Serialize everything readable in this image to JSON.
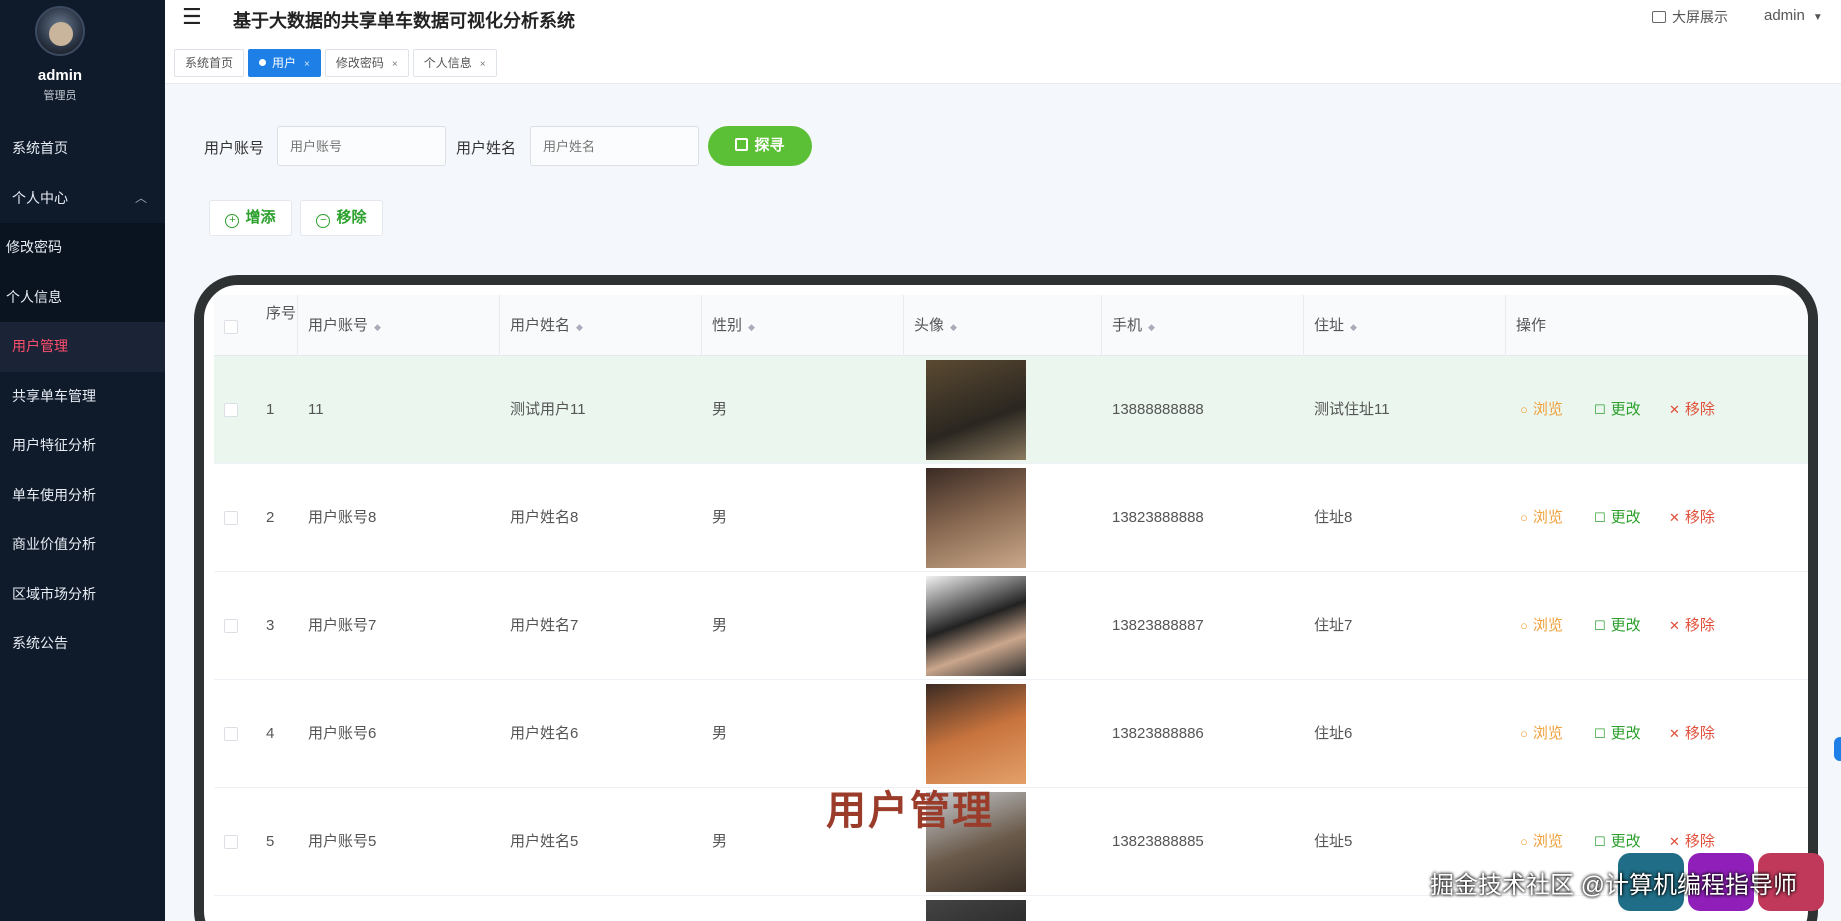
{
  "sidebar": {
    "user_name": "admin",
    "user_role": "管理员",
    "items": [
      {
        "label": "系统首页"
      },
      {
        "label": "个人中心"
      },
      {
        "label": "修改密码"
      },
      {
        "label": "个人信息"
      },
      {
        "label": "用户管理"
      },
      {
        "label": "共享单车管理"
      },
      {
        "label": "用户特征分析"
      },
      {
        "label": "单车使用分析"
      },
      {
        "label": "商业价值分析"
      },
      {
        "label": "区域市场分析"
      },
      {
        "label": "系统公告"
      }
    ]
  },
  "header": {
    "title": "基于大数据的共享单车数据可视化分析系统",
    "big_screen": "大屏展示",
    "admin": "admin"
  },
  "tabs": [
    {
      "label": "系统首页"
    },
    {
      "label": "用户"
    },
    {
      "label": "修改密码"
    },
    {
      "label": "个人信息"
    }
  ],
  "search": {
    "account_label": "用户账号",
    "account_placeholder": "用户账号",
    "name_label": "用户姓名",
    "name_placeholder": "用户姓名",
    "button": "探寻"
  },
  "toolbar": {
    "add": "增添",
    "remove": "移除"
  },
  "table": {
    "headers": {
      "index": "序号",
      "account": "用户账号",
      "name": "用户姓名",
      "gender": "性别",
      "avatar": "头像",
      "phone": "手机",
      "address": "住址",
      "ops": "操作"
    },
    "rows": [
      {
        "index": "1",
        "account": "11",
        "name": "测试用户11",
        "gender": "男",
        "phone": "13888888888",
        "address": "测试住址11"
      },
      {
        "index": "2",
        "account": "用户账号8",
        "name": "用户姓名8",
        "gender": "男",
        "phone": "13823888888",
        "address": "住址8"
      },
      {
        "index": "3",
        "account": "用户账号7",
        "name": "用户姓名7",
        "gender": "男",
        "phone": "13823888887",
        "address": "住址7"
      },
      {
        "index": "4",
        "account": "用户账号6",
        "name": "用户姓名6",
        "gender": "男",
        "phone": "13823888886",
        "address": "住址6"
      },
      {
        "index": "5",
        "account": "用户账号5",
        "name": "用户姓名5",
        "gender": "男",
        "phone": "13823888885",
        "address": "住址5"
      }
    ],
    "actions": {
      "view": "浏览",
      "edit": "更改",
      "delete": "移除"
    }
  },
  "overlay": {
    "caption": "用户管理",
    "watermark": "掘金技术社区 @计算机编程指导师"
  },
  "colors": {
    "sidebar_bg": "#0f1a2b",
    "active_menu": "#ff4d6d",
    "active_tab": "#1e7fe6",
    "search_button": "#5cc036",
    "view": "#f0a03c",
    "edit": "#2ca02c",
    "delete": "#e0503b"
  }
}
